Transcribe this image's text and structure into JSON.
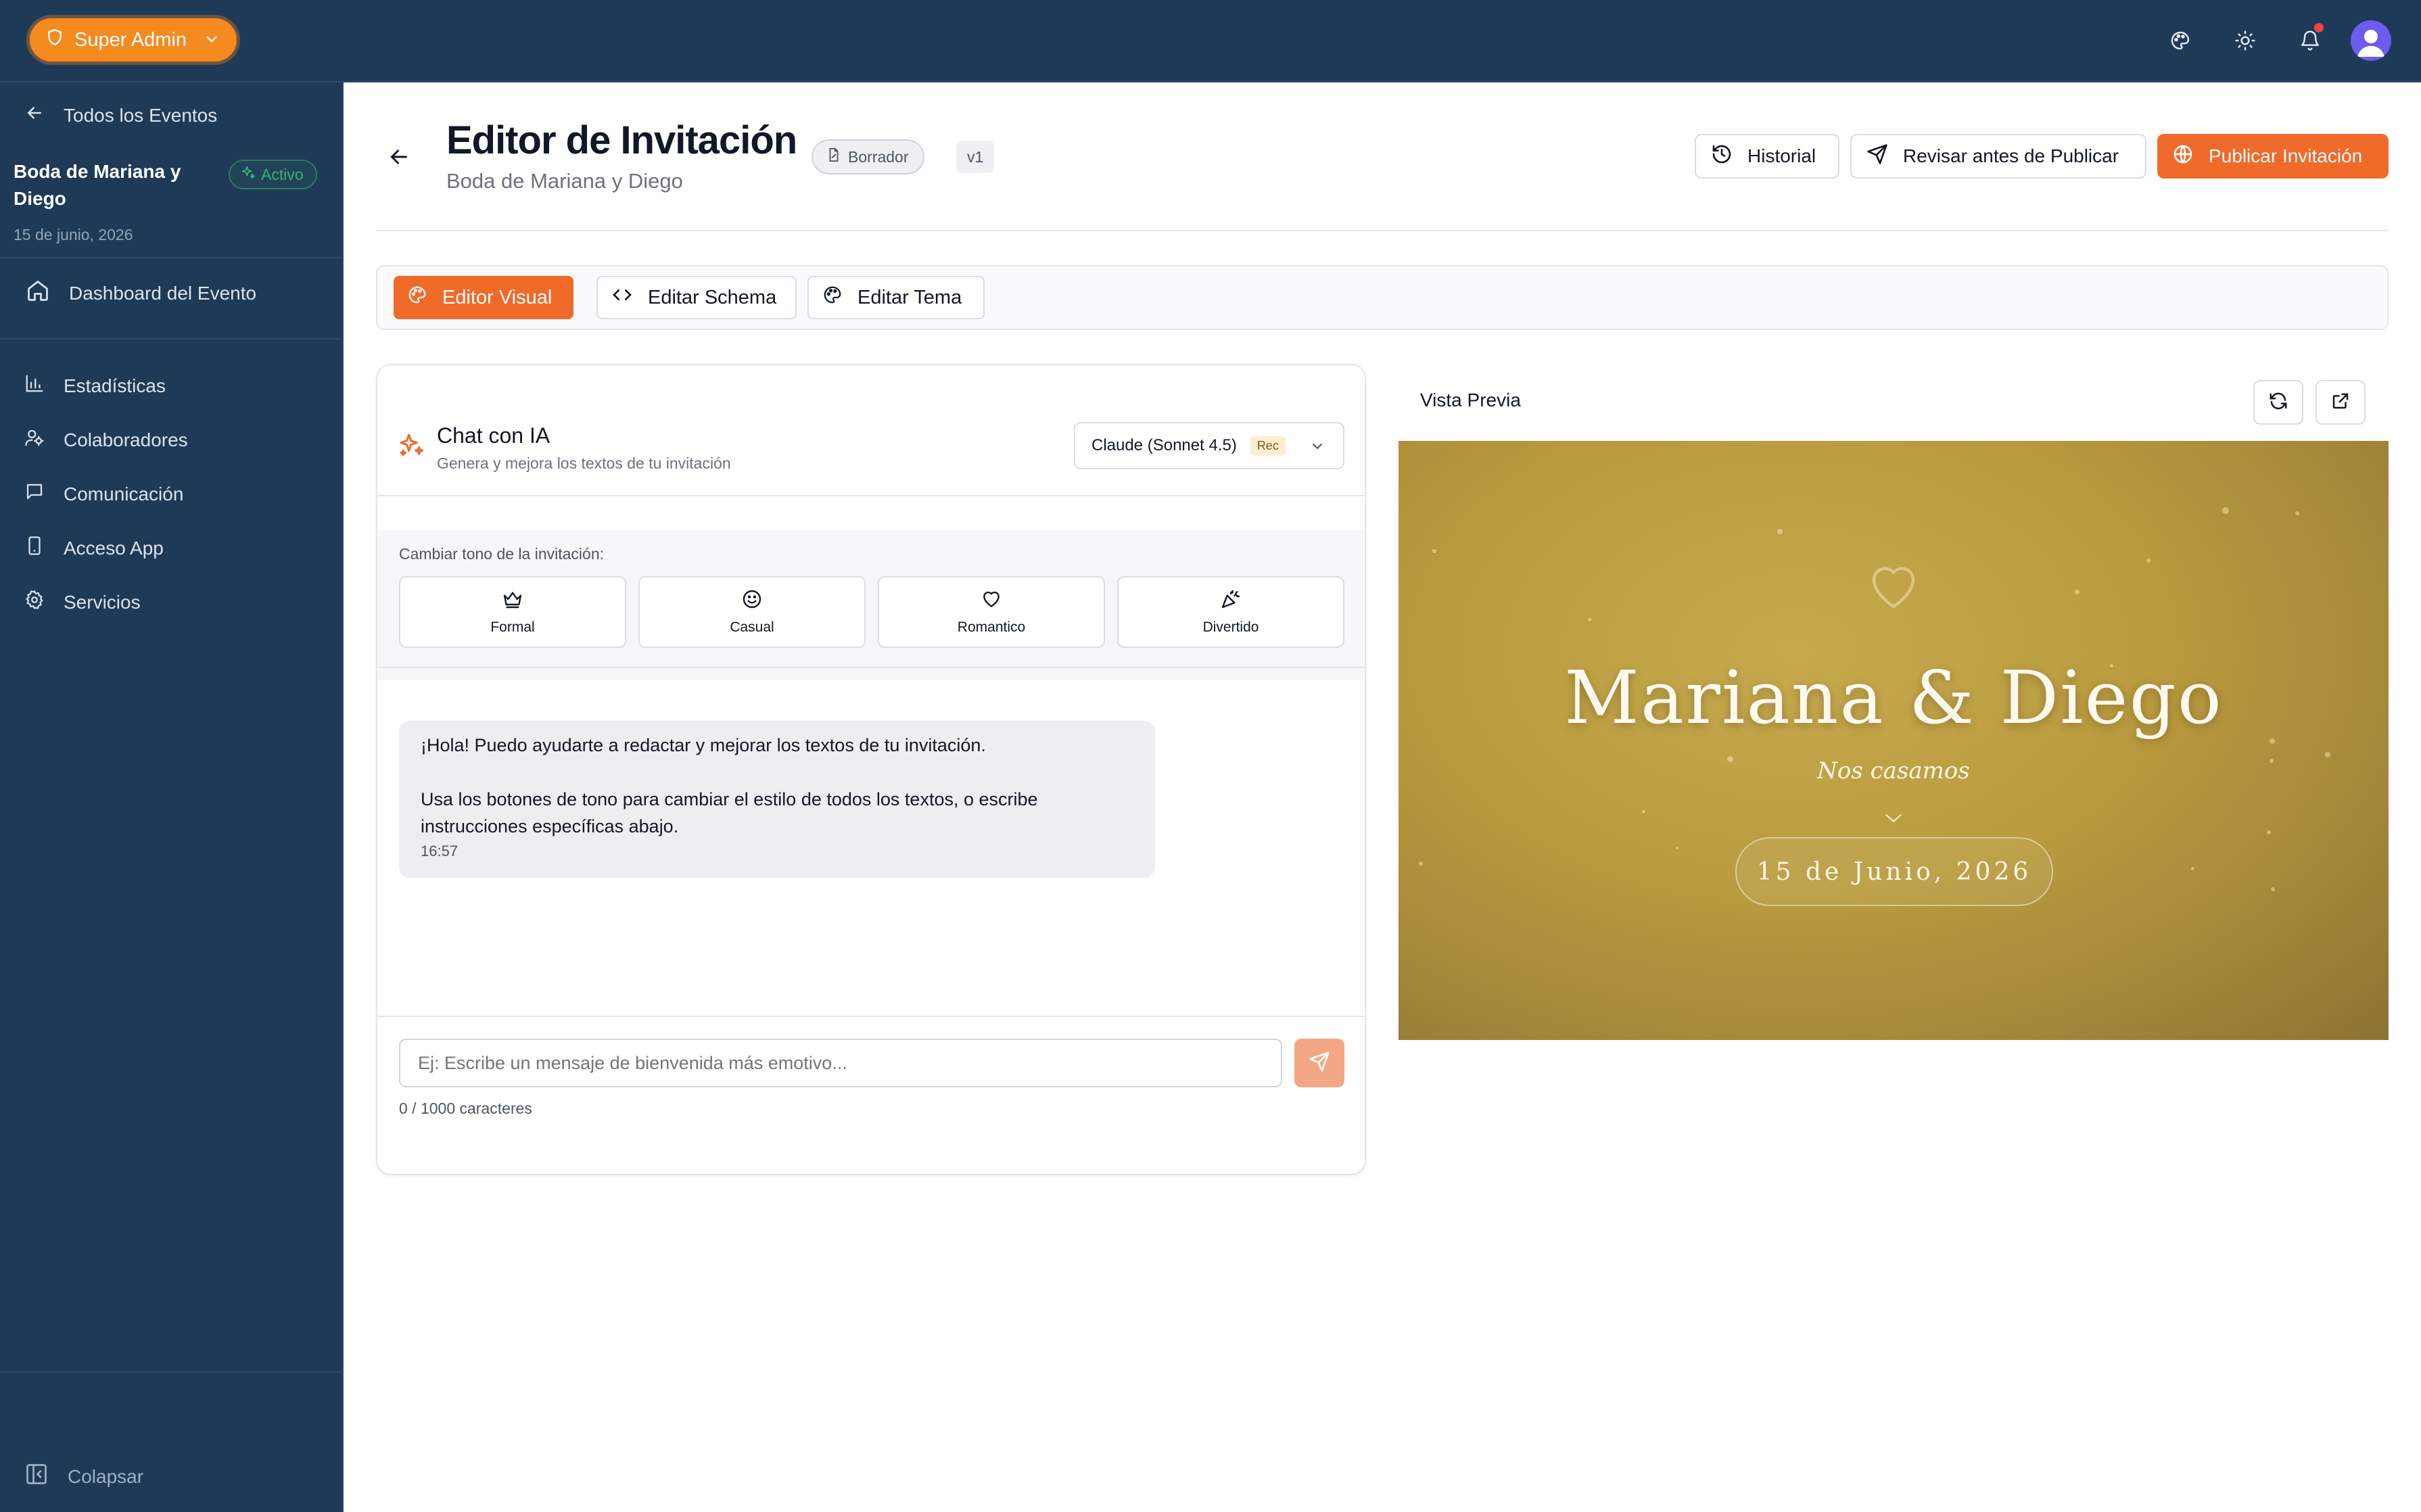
{
  "topbar": {
    "role_label": "Super Admin",
    "icons": [
      "palette-icon",
      "sun-icon",
      "bell-icon",
      "avatar"
    ]
  },
  "sidebar": {
    "back_label": "Todos los Eventos",
    "event_title": "Boda de Mariana y Diego",
    "event_status": "Activo",
    "event_date": "15 de junio, 2026",
    "items": [
      {
        "label": "Dashboard del Evento",
        "icon": "home-icon"
      },
      {
        "label": "Estadísticas",
        "icon": "bar-chart-icon"
      },
      {
        "label": "Colaboradores",
        "icon": "users-icon"
      },
      {
        "label": "Comunicación",
        "icon": "message-icon"
      },
      {
        "label": "Acceso App",
        "icon": "smartphone-icon"
      },
      {
        "label": "Servicios",
        "icon": "gear-icon"
      }
    ],
    "collapse_label": "Colapsar"
  },
  "header": {
    "title": "Editor de Invitación",
    "subtitle": "Boda de Mariana y Diego",
    "status_chip": "Borrador",
    "version": "v1",
    "history_label": "Historial",
    "review_label": "Revisar antes de Publicar",
    "publish_label": "Publicar Invitación"
  },
  "tabs": [
    {
      "label": "Editor Visual",
      "active": true
    },
    {
      "label": "Editar Schema",
      "active": false
    },
    {
      "label": "Editar Tema",
      "active": false
    }
  ],
  "chat": {
    "title": "Chat con IA",
    "subtitle": "Genera y mejora los textos de tu invitación",
    "model": "Claude (Sonnet 4.5)",
    "model_badge": "Rec",
    "tone_label": "Cambiar tono de la invitación:",
    "tones": [
      {
        "label": "Formal",
        "icon": "crown-icon"
      },
      {
        "label": "Casual",
        "icon": "smile-icon"
      },
      {
        "label": "Romantico",
        "icon": "heart-icon"
      },
      {
        "label": "Divertido",
        "icon": "party-popper-icon"
      }
    ],
    "message": {
      "line1": "¡Hola! Puedo ayudarte a redactar y mejorar los textos de tu invitación.",
      "line2": "Usa los botones de tono para cambiar el estilo de todos los textos, o escribe instrucciones específicas abajo.",
      "time": "16:57"
    },
    "input_placeholder": "Ej: Escribe un mensaje de bienvenida más emotivo...",
    "char_count": "0 / 1000 caracteres"
  },
  "preview": {
    "label": "Vista Previa",
    "names": "Mariana & Diego",
    "tagline": "Nos casamos",
    "date": "15 de Junio, 2026"
  },
  "colors": {
    "topbar": "#1f3a57",
    "accent": "#f06a2a",
    "admin": "#f58a1f",
    "preview_gold": "#b99a3e"
  }
}
